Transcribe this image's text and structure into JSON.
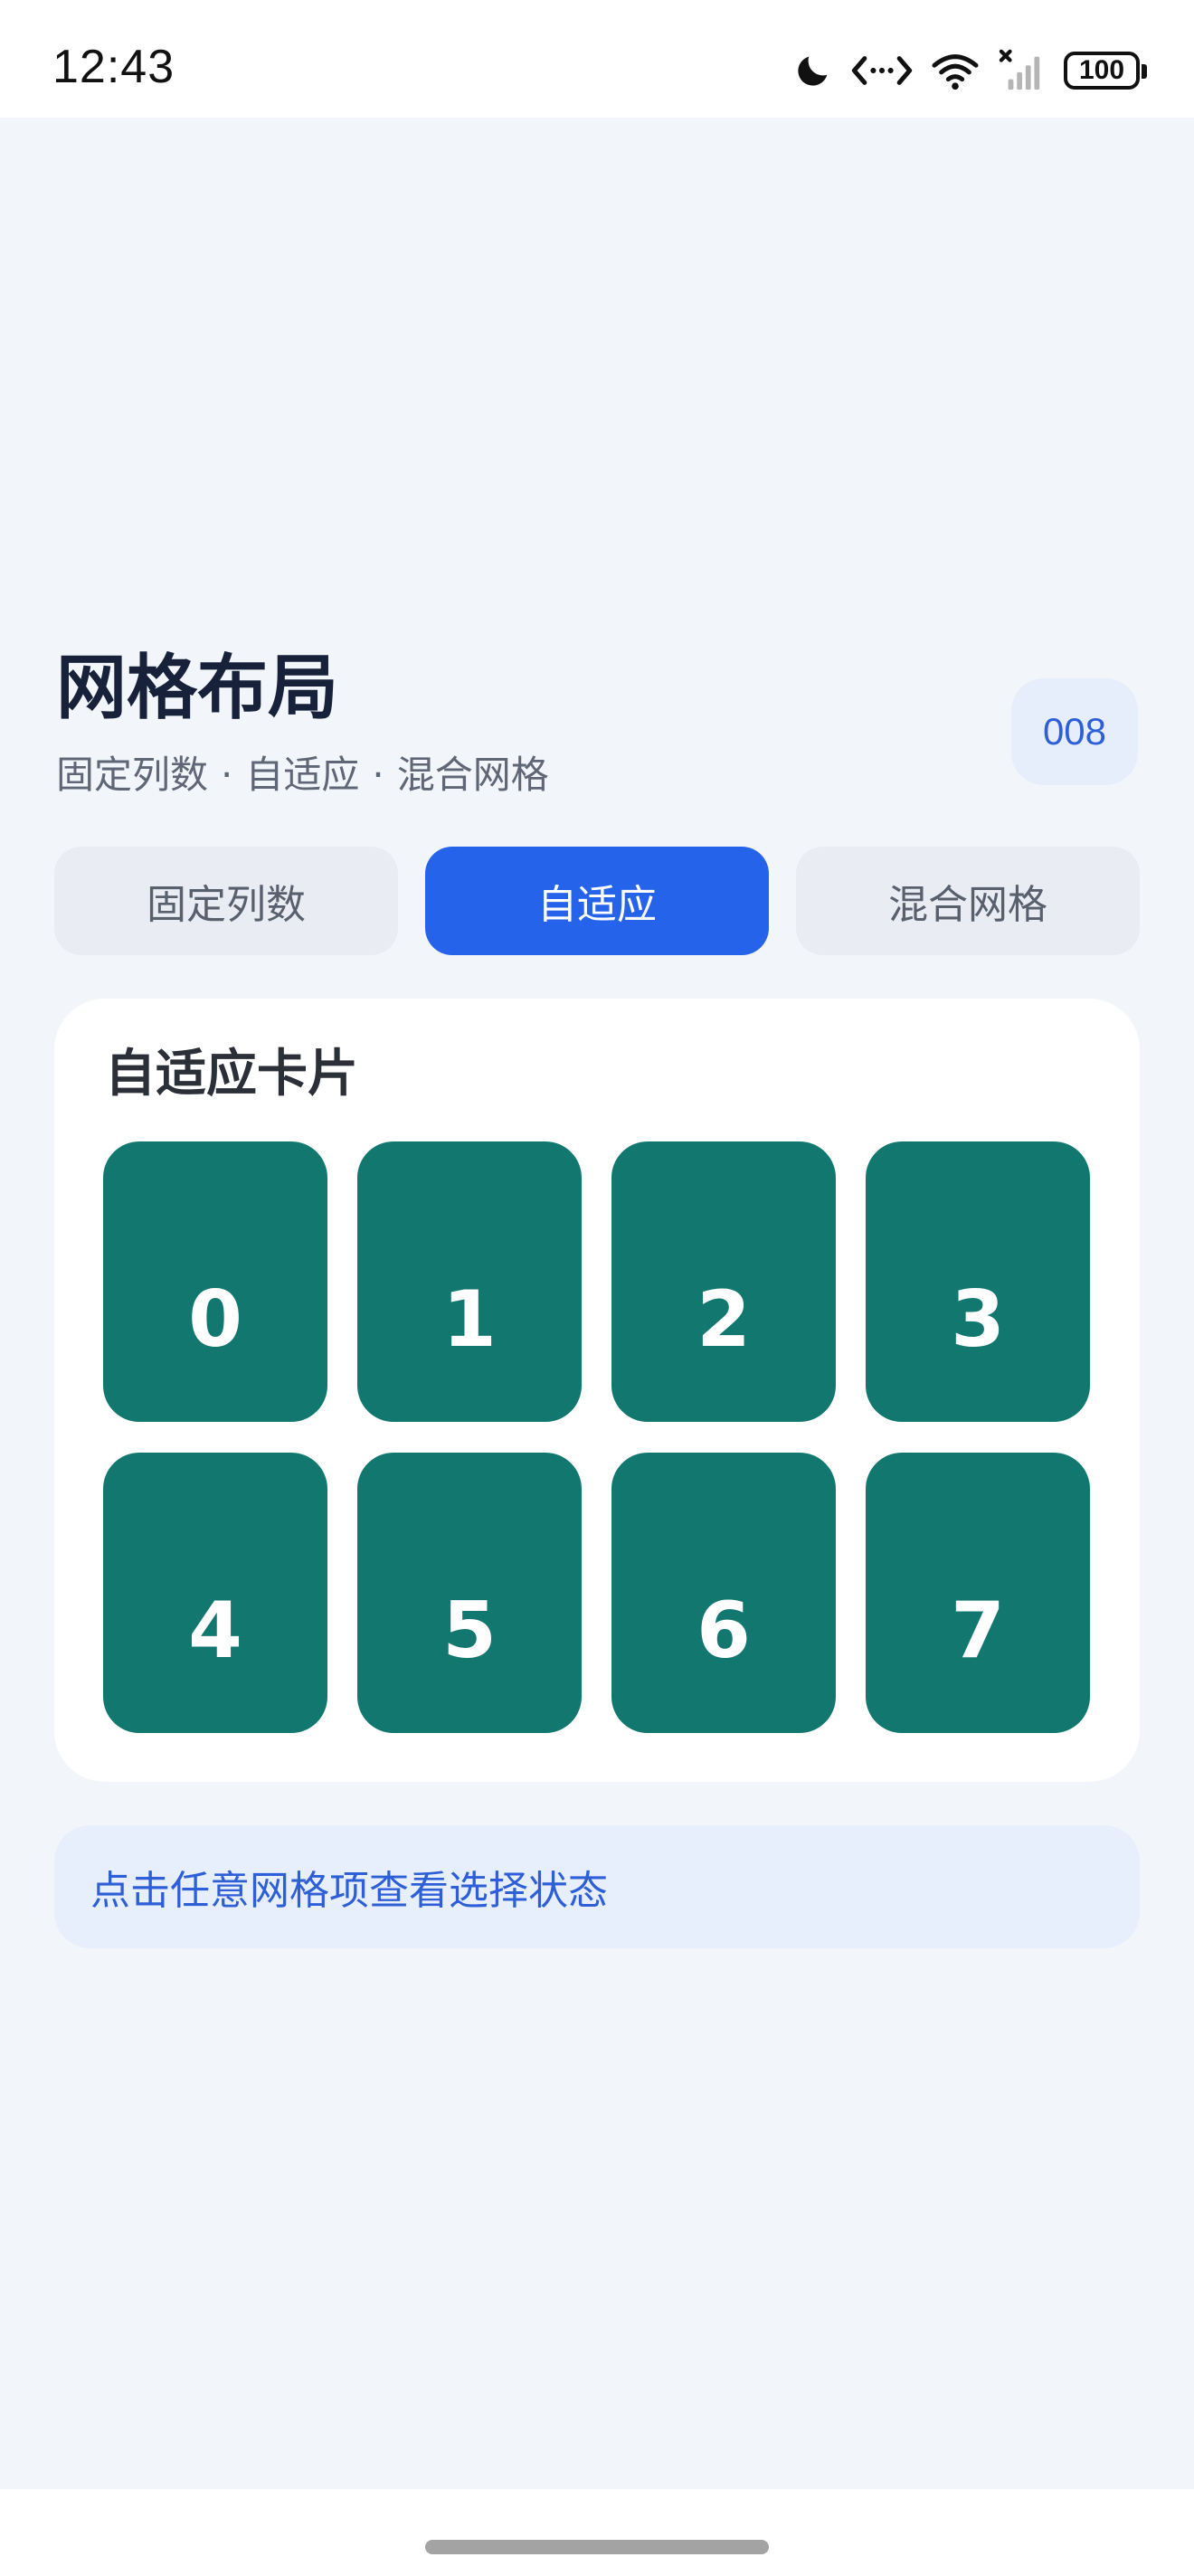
{
  "status_bar": {
    "time": "12:43",
    "battery": "100",
    "icons": [
      "moon-icon",
      "code-arrows-icon",
      "wifi-icon",
      "signal-icon",
      "battery-icon"
    ]
  },
  "header": {
    "title": "网格布局",
    "subtitle": {
      "parts": [
        "固定列数",
        "自适应",
        "混合网格"
      ],
      "separator": "·"
    },
    "badge": "008"
  },
  "tabs": [
    {
      "label": "固定列数",
      "active": false
    },
    {
      "label": "自适应",
      "active": true
    },
    {
      "label": "混合网格",
      "active": false
    }
  ],
  "card": {
    "title": "自适应卡片",
    "tiles": [
      "0",
      "1",
      "2",
      "3",
      "4",
      "5",
      "6",
      "7"
    ]
  },
  "hint": "点击任意网格项查看选择状态",
  "colors": {
    "accent": "#2563eb",
    "tile": "#11776f",
    "background": "#f2f5fa",
    "hint_bg": "#e7effd",
    "hint_text": "#2f5fd6"
  }
}
